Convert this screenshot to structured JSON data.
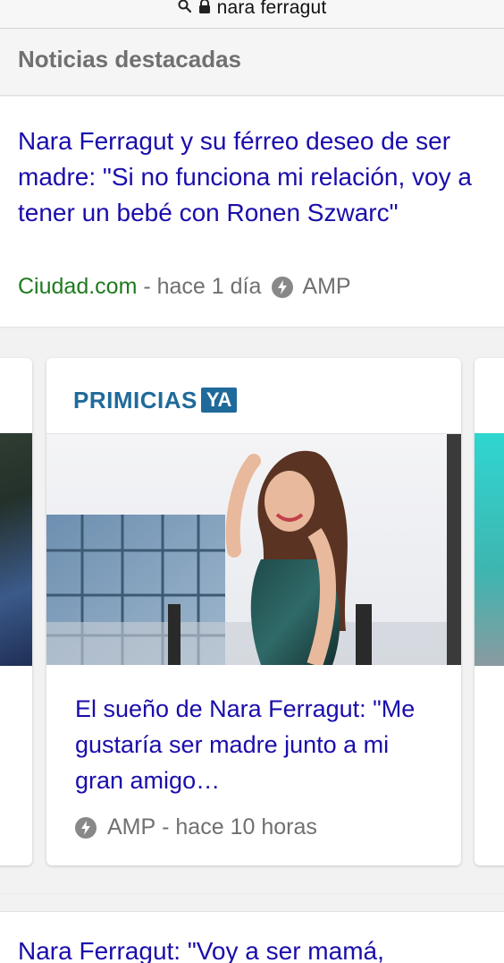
{
  "url_bar": {
    "url": "nara ferragut",
    "search_icon": "search-icon",
    "lock_icon": "lock-icon"
  },
  "section": {
    "title": "Noticias destacadas"
  },
  "top_story": {
    "headline": "Nara Ferragut y su férreo deseo de ser madre: \"Si no funciona mi relación, voy a tener un bebé con Ronen Szwarc\"",
    "source": "Ciudad.com",
    "separator": " - ",
    "time": "hace 1 día",
    "amp_label": "AMP",
    "amp_icon": "amp-bolt-icon"
  },
  "carousel": {
    "main_card": {
      "logo_text": "PRIMICIAS",
      "logo_badge": "YA",
      "headline": "El sueño de Nara Ferragut: \"Me gustaría ser madre junto a mi gran amigo…",
      "amp_label": "AMP",
      "separator": " - ",
      "time": "hace 10 horas",
      "amp_icon": "amp-bolt-icon"
    }
  },
  "next_story": {
    "headline": "Nara Ferragut: \"Voy a ser mamá,"
  },
  "colors": {
    "link": "#1a0dab",
    "source_green": "#1e7a1e",
    "meta_gray": "#707070",
    "brand_blue": "#1f6a9a"
  }
}
